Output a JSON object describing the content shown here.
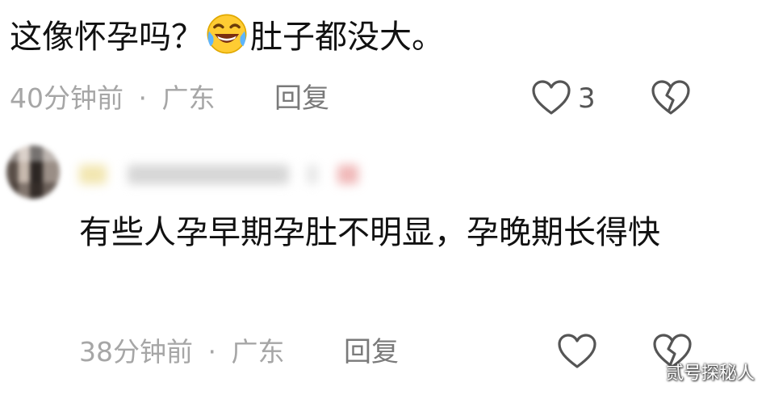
{
  "comments": [
    {
      "text_before_emoji": "这像怀孕吗？",
      "emoji": "laughing-crying-emoji",
      "text_after_emoji": "肚子都没大。",
      "time": "40分钟前",
      "separator": "·",
      "location": "广东",
      "reply_label": "回复",
      "like_count": "3"
    },
    {
      "text": "有些人孕早期孕肚不明显，孕晚期长得快",
      "time": "38分钟前",
      "separator": "·",
      "location": "广东",
      "reply_label": "回复"
    }
  ],
  "watermark": "贰号探秘人",
  "colors": {
    "text": "#111111",
    "meta": "#a6a6a6",
    "reply": "#7a7a7a",
    "icon": "#555555"
  }
}
